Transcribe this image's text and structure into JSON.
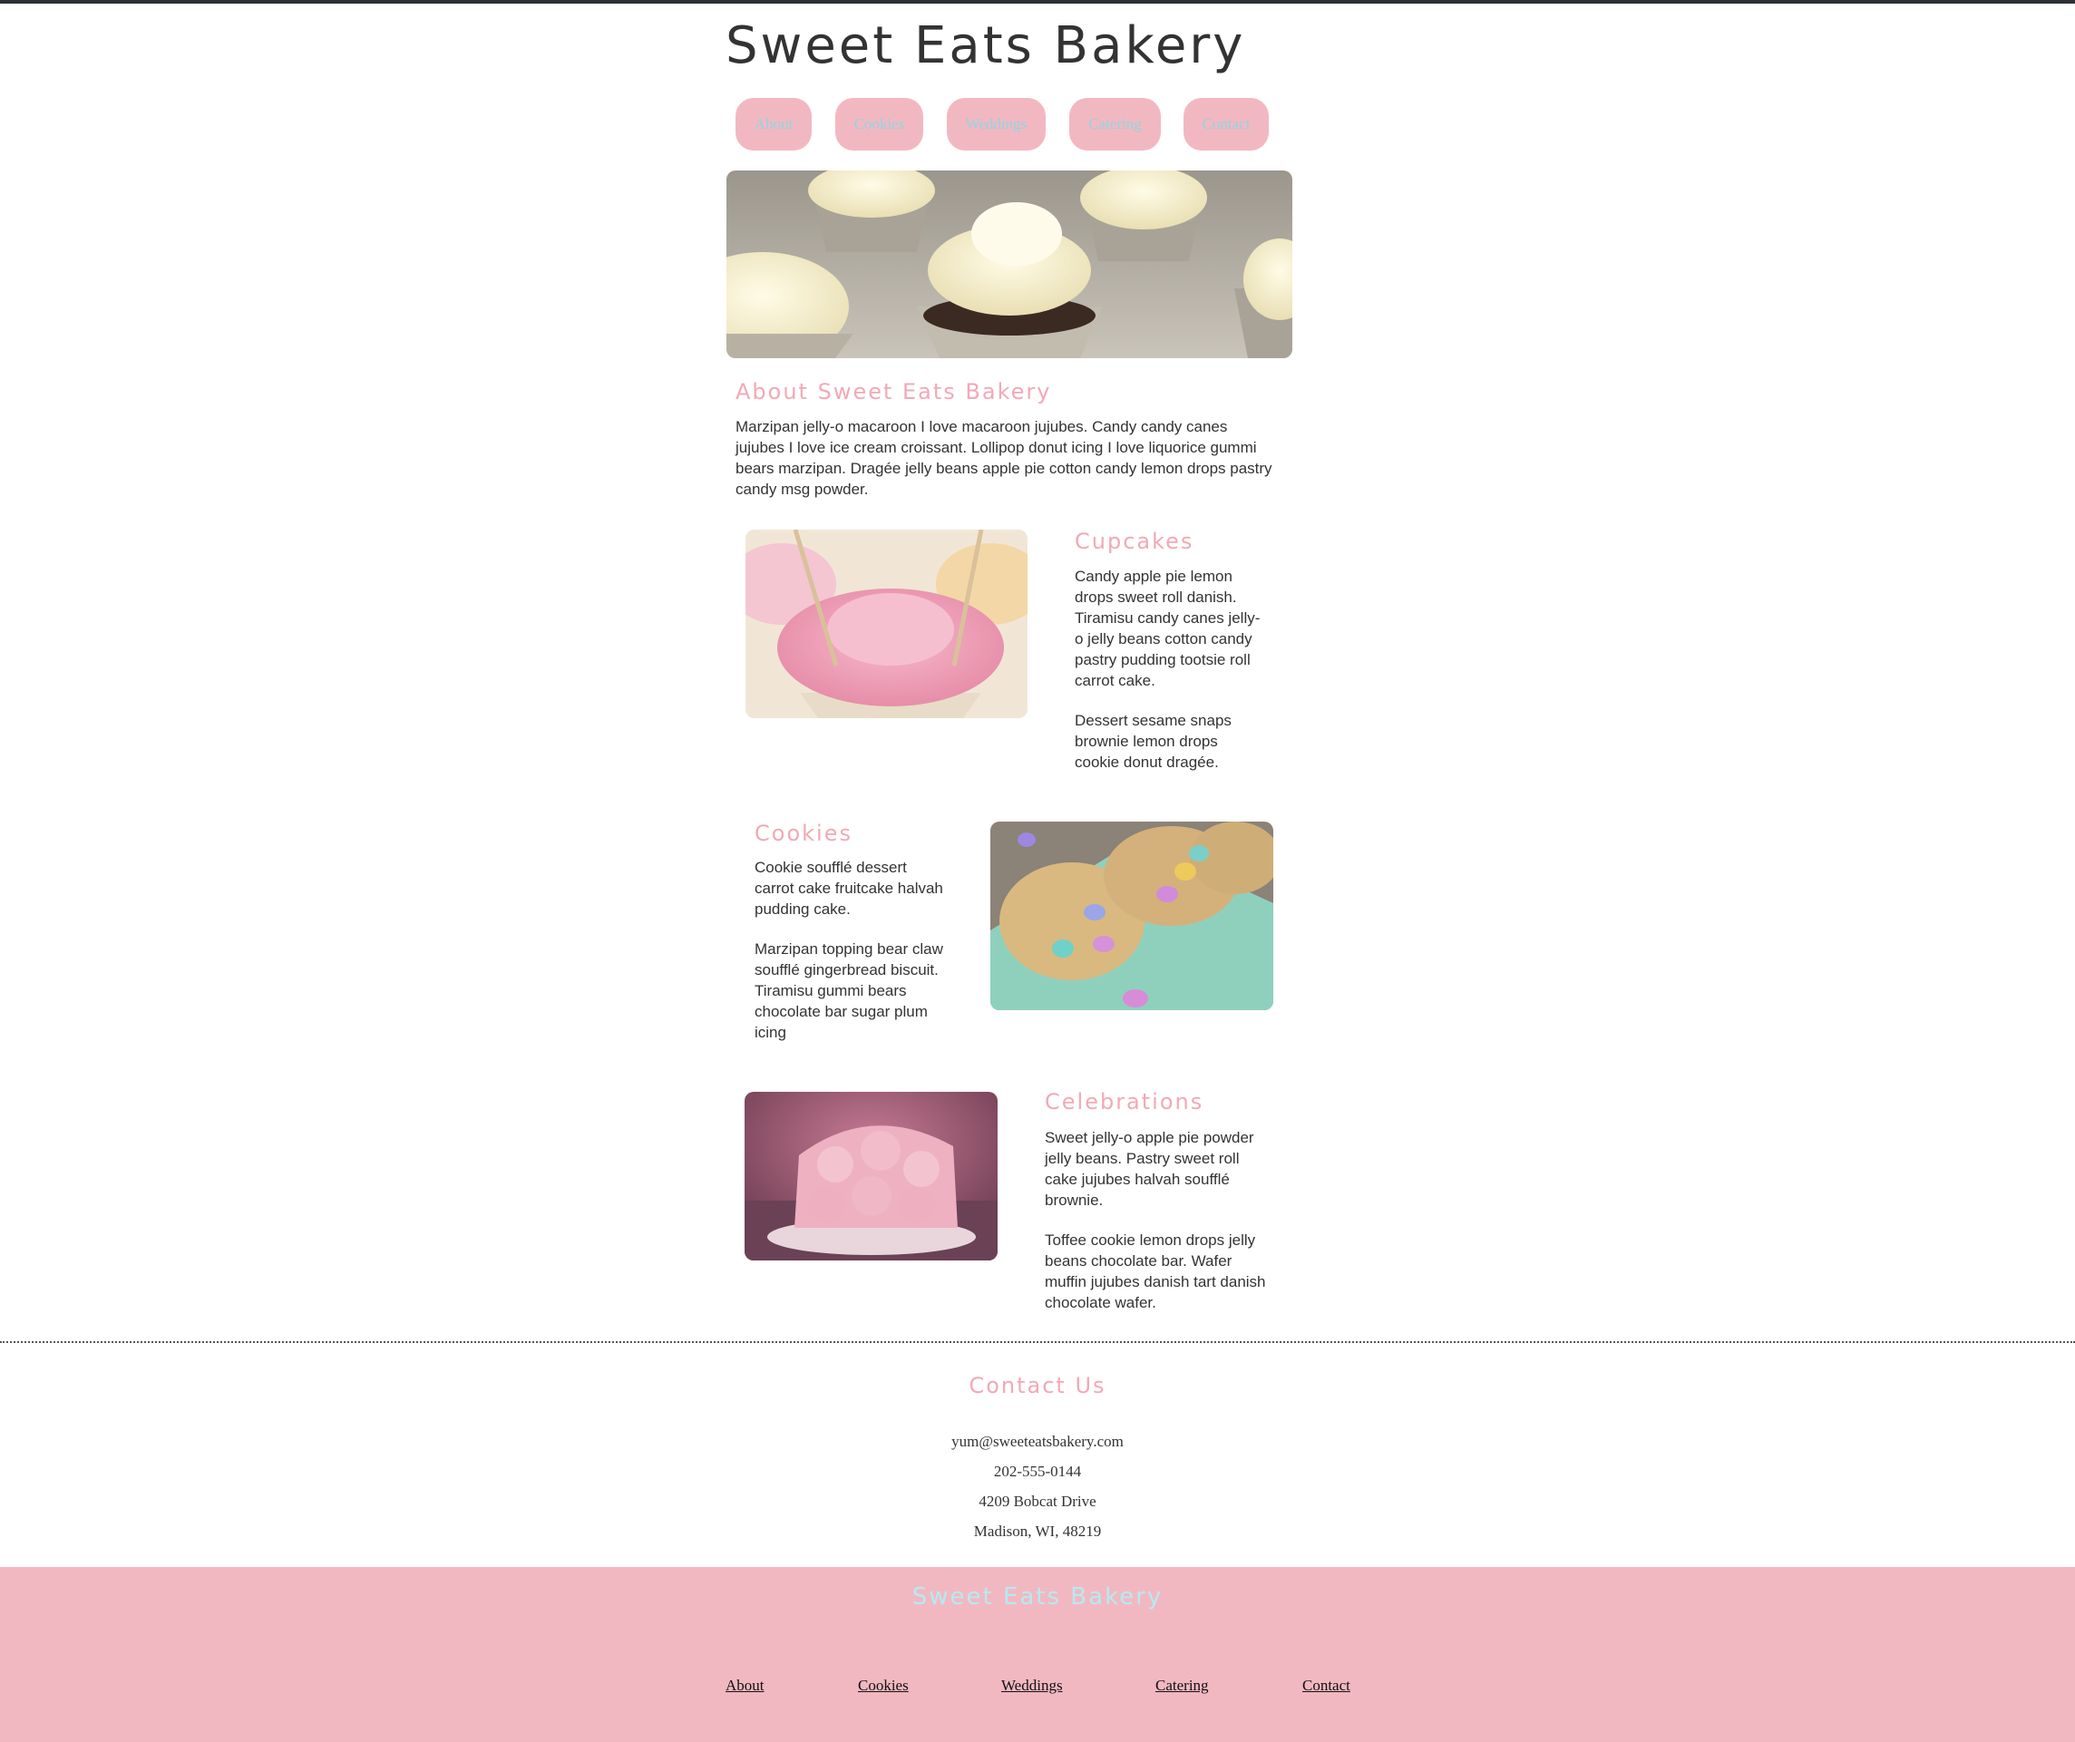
{
  "site": {
    "title": "Sweet Eats Bakery"
  },
  "nav": [
    {
      "label": "About"
    },
    {
      "label": "Cookies"
    },
    {
      "label": "Weddings"
    },
    {
      "label": "Catering"
    },
    {
      "label": "Contact"
    }
  ],
  "about": {
    "heading": "About Sweet Eats Bakery",
    "body": "Marzipan jelly-o macaroon I love macaroon jujubes. Candy candy canes jujubes I love ice cream croissant. Lollipop donut icing I love liquorice gummi bears marzipan. Dragée jelly beans apple pie cotton candy lemon drops pastry candy msg powder."
  },
  "sections": {
    "cupcakes": {
      "heading": "Cupcakes",
      "p1": "Candy apple pie lemon drops sweet roll danish. Tiramisu candy canes jelly-o jelly beans cotton candy pastry pudding tootsie roll carrot cake.",
      "p2": "Dessert sesame snaps brownie lemon drops cookie donut dragée."
    },
    "cookies": {
      "heading": "Cookies",
      "p1": "Cookie soufflé dessert carrot cake fruitcake halvah pudding cake.",
      "p2": "Marzipan topping bear claw soufflé gingerbread biscuit. Tiramisu gummi bears chocolate bar sugar plum icing"
    },
    "celebrations": {
      "heading": "Celebrations",
      "p1": "Sweet jelly-o apple pie powder jelly beans. Pastry sweet roll cake jujubes halvah soufflé brownie.",
      "p2": "Toffee cookie lemon drops jelly beans chocolate bar. Wafer muffin jujubes danish tart danish chocolate wafer."
    }
  },
  "contact": {
    "heading": "Contact Us",
    "email": "yum@sweeteatsbakery.com",
    "phone": "202-555-0144",
    "street": "4209 Bobcat Drive",
    "city": "Madison, WI, 48219"
  },
  "footer": {
    "title": "Sweet Eats Bakery",
    "links": [
      {
        "label": "About"
      },
      {
        "label": "Cookies"
      },
      {
        "label": "Weddings"
      },
      {
        "label": "Catering"
      },
      {
        "label": "Contact"
      }
    ]
  },
  "colors": {
    "accent_pink": "#f2b8c1",
    "heading_pink": "#f2a9b5",
    "nav_text": "#8fd6e0",
    "footer_title": "#b6eaf2"
  }
}
